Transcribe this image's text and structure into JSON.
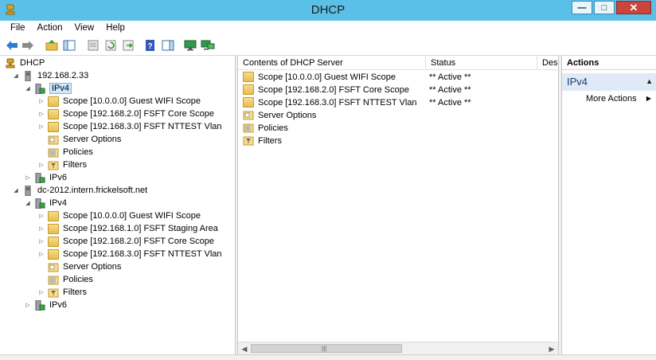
{
  "window": {
    "title": "DHCP"
  },
  "menu": [
    "File",
    "Action",
    "View",
    "Help"
  ],
  "toolbar": {
    "icons": [
      "back-arrow-icon",
      "forward-arrow-icon",
      "up-folder-icon",
      "show-hide-tree-icon",
      "properties-icon",
      "refresh-icon",
      "export-list-icon",
      "help-icon",
      "show-hide-action-pane-icon",
      "monitor-icon",
      "monitor-network-icon"
    ]
  },
  "tree": {
    "root": "DHCP",
    "servers": [
      {
        "name": "192.168.2.33",
        "ipv4": "IPv4",
        "scopes": [
          "Scope [10.0.0.0] Guest WIFI Scope",
          "Scope [192.168.2.0] FSFT Core Scope",
          "Scope [192.168.3.0] FSFT NTTEST Vlan"
        ],
        "server_options": "Server Options",
        "policies": "Policies",
        "filters": "Filters",
        "ipv6": "IPv6"
      },
      {
        "name": "dc-2012.intern.frickelsoft.net",
        "ipv4": "IPv4",
        "scopes": [
          "Scope [10.0.0.0] Guest WIFI Scope",
          "Scope [192.168.1.0] FSFT Staging Area",
          "Scope [192.168.2.0] FSFT Core Scope",
          "Scope [192.168.3.0] FSFT NTTEST Vlan"
        ],
        "server_options": "Server Options",
        "policies": "Policies",
        "filters": "Filters",
        "ipv6": "IPv6"
      }
    ]
  },
  "content": {
    "columns": [
      "Contents of DHCP Server",
      "Status",
      "Desc"
    ],
    "rows": [
      {
        "name": "Scope [10.0.0.0] Guest WIFI Scope",
        "status": "** Active **",
        "icon": "folder-icon"
      },
      {
        "name": "Scope [192.168.2.0] FSFT Core Scope",
        "status": "** Active **",
        "icon": "folder-icon"
      },
      {
        "name": "Scope [192.168.3.0] FSFT NTTEST Vlan",
        "status": "** Active **",
        "icon": "folder-icon"
      },
      {
        "name": "Server Options",
        "status": "",
        "icon": "server-options-icon"
      },
      {
        "name": "Policies",
        "status": "",
        "icon": "policies-icon"
      },
      {
        "name": "Filters",
        "status": "",
        "icon": "filters-icon"
      }
    ]
  },
  "actions": {
    "header": "Actions",
    "section": "IPv4",
    "items": [
      "More Actions"
    ]
  }
}
